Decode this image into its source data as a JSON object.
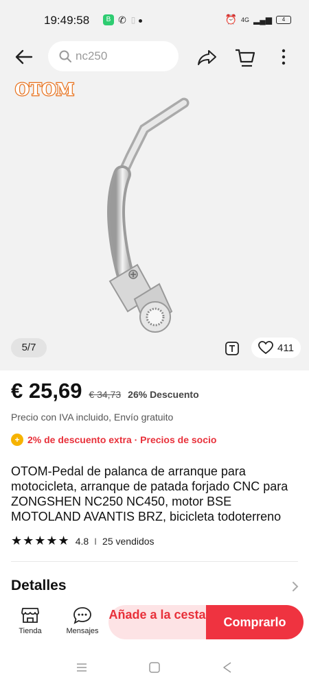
{
  "status_bar": {
    "time": "19:49:58",
    "network": "4G",
    "battery": "4"
  },
  "search": {
    "query": "nc250"
  },
  "brand_logo_text": "OTOM",
  "gallery": {
    "pager": "5/7",
    "wishlist_count": "411"
  },
  "price": {
    "current": "€ 25,69",
    "original": "€ 34,73",
    "discount": "26% Descuento",
    "tax_note": "Precio con IVA incluido, Envío gratuito",
    "promo": "2% de descuento extra · Precios de socio"
  },
  "product": {
    "title": "OTOM-Pedal de palanca de arranque para motocicleta, arranque de patada forjado CNC para ZONGSHEN NC250 NC450, motor BSE MOTOLAND AVANTIS BRZ, bicicleta todoterreno",
    "stars": "★★★★★",
    "rating": "4.8",
    "separator": "I",
    "sold": "25 vendidos"
  },
  "details_label": "Detalles",
  "bottom_bar": {
    "store_label": "Tienda",
    "messages_label": "Mensajes",
    "add_to_cart_label": "Añade a la cesta",
    "buy_label": "Comprarlo"
  },
  "colors": {
    "accent": "#ef3340",
    "accent_light": "#fde3e5",
    "promo_red": "#e8303a",
    "logo_orange": "#e8701a"
  }
}
